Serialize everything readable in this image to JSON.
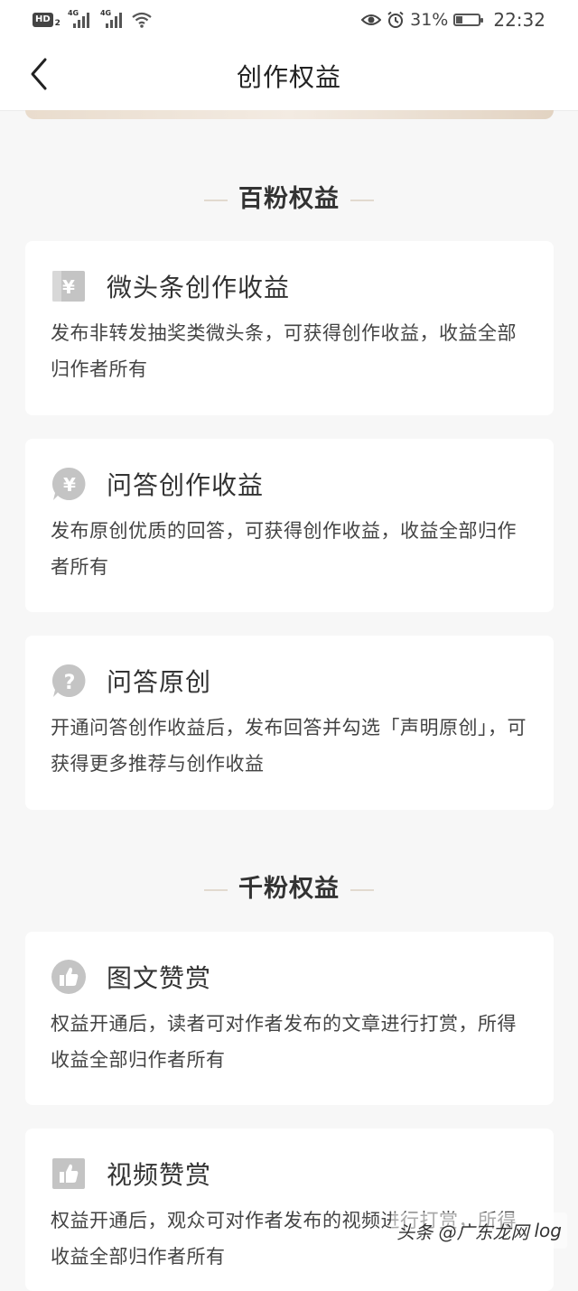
{
  "status_bar": {
    "hd": "HD",
    "hd_sub": "2",
    "net1": "4G",
    "net2": "4G",
    "battery_percent": "31%",
    "battery_level": 0.31,
    "time": "22:32",
    "icons": [
      "eye-icon",
      "alarm-icon",
      "battery-icon",
      "wifi-icon",
      "signal-icon"
    ]
  },
  "nav": {
    "back_icon": "chevron-left-icon",
    "title": "创作权益"
  },
  "sections": [
    {
      "title": "百粉权益",
      "cards": [
        {
          "icon": "yuan-square-icon",
          "title": "微头条创作收益",
          "desc": "发布非转发抽奖类微头条，可获得创作收益，收益全部归作者所有"
        },
        {
          "icon": "yuan-bubble-icon",
          "title": "问答创作收益",
          "desc": "发布原创优质的回答，可获得创作收益，收益全部归作者所有"
        },
        {
          "icon": "question-bubble-icon",
          "title": "问答原创",
          "desc": "开通问答创作收益后，发布回答并勾选「声明原创」，可获得更多推荐与创作收益"
        }
      ]
    },
    {
      "title": "千粉权益",
      "cards": [
        {
          "icon": "thumbs-up-circle-icon",
          "title": "图文赞赏",
          "desc": "权益开通后，读者可对作者发布的文章进行打赏，所得收益全部归作者所有"
        },
        {
          "icon": "thumbs-up-square-icon",
          "title": "视频赞赏",
          "desc": "权益开通后，观众可对作者发布的视频进行打赏，所得收益全部归作者所有"
        }
      ]
    }
  ],
  "watermark": {
    "text": "头条 @广东龙网",
    "tail": "log"
  },
  "colors": {
    "background": "#f7f7f7",
    "card": "#ffffff",
    "icon_gray": "#c4c4c4",
    "banner": "#e9dccd"
  }
}
